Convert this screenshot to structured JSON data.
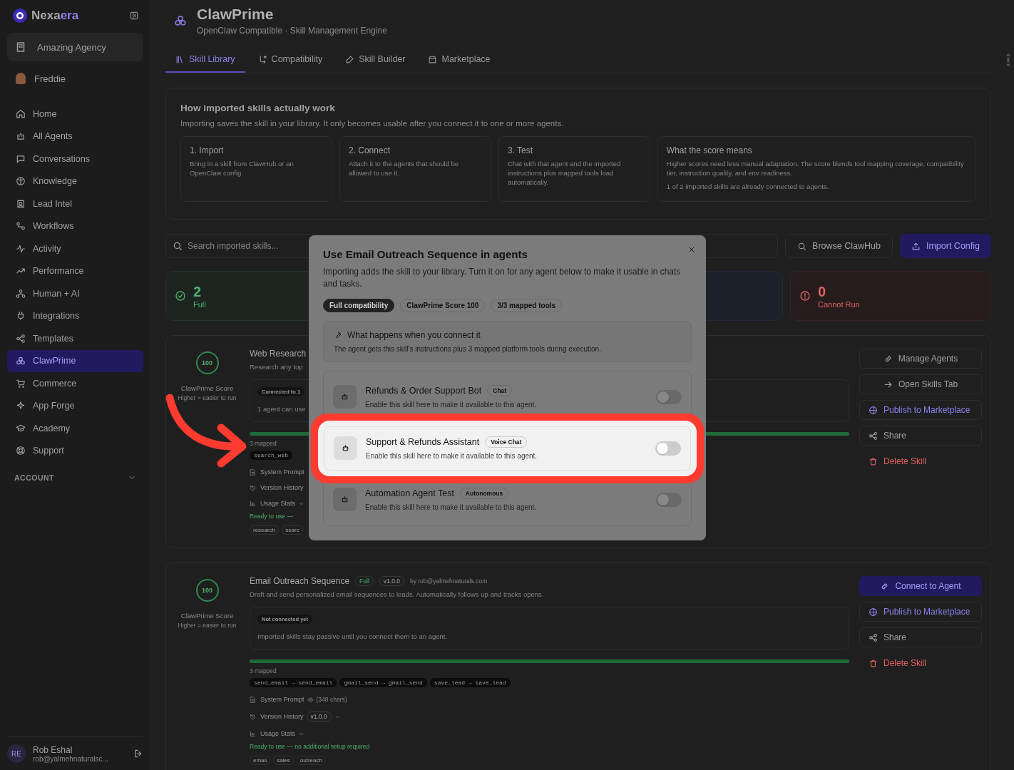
{
  "sidebar": {
    "logo": [
      {
        "text": "Nexa",
        "accent": false
      },
      {
        "text": "era",
        "accent": true
      }
    ],
    "workspace": "Amazing Agency",
    "user": "Freddie",
    "nav": [
      {
        "label": "Home",
        "selected": false
      },
      {
        "label": "All Agents",
        "selected": false
      },
      {
        "label": "Conversations",
        "selected": false
      },
      {
        "label": "Knowledge",
        "selected": false
      },
      {
        "label": "Lead Intel",
        "selected": false
      },
      {
        "label": "Workflows",
        "selected": false
      },
      {
        "label": "Activity",
        "selected": false
      },
      {
        "label": "Performance",
        "selected": false
      },
      {
        "label": "Human + AI",
        "selected": false
      },
      {
        "label": "Integrations",
        "selected": false
      },
      {
        "label": "Templates",
        "selected": false
      },
      {
        "label": "ClawPrime",
        "selected": true
      },
      {
        "label": "Commerce",
        "selected": false
      },
      {
        "label": "App Forge",
        "selected": false
      },
      {
        "label": "Academy",
        "selected": false
      },
      {
        "label": "Support",
        "selected": false
      }
    ],
    "section": "ACCOUNT",
    "footer": {
      "initials": "RE",
      "name": "Rob Eshal",
      "email": "rob@yalmehnaturalsc..."
    }
  },
  "header": {
    "title": "ClawPrime",
    "subtitle": "OpenClaw Compatible · Skill Management Engine"
  },
  "tabs": [
    {
      "label": "Skill Library",
      "selected": true
    },
    {
      "label": "Compatibility",
      "selected": false
    },
    {
      "label": "Skill Builder",
      "selected": false
    },
    {
      "label": "Marketplace",
      "selected": false
    }
  ],
  "info": {
    "title": "How imported skills actually work",
    "text": "Importing saves the skill in your library. It only becomes usable after you connect it to one or more agents.",
    "steps": [
      {
        "title": "1. Import",
        "text": "Bring in a skill from ClawHub or an OpenClaw config."
      },
      {
        "title": "2. Connect",
        "text": "Attach it to the agents that should be allowed to use it."
      },
      {
        "title": "3. Test",
        "text": "Chat with that agent and the imported instructions plus mapped tools load automatically."
      },
      {
        "title": "What the score means",
        "text": "Higher scores need less manual adaptation. The score blends tool mapping coverage, compatibility tier, instruction quality, and env readiness.",
        "note": "1 of 2 imported skills are already connected to agents."
      }
    ]
  },
  "search": {
    "placeholder": "Search imported skills..."
  },
  "actions": [
    {
      "label": "Browse ClawHub",
      "kind": "outline"
    },
    {
      "label": "Import Config",
      "kind": "primary"
    }
  ],
  "stats": [
    {
      "kind": "green",
      "value": "2",
      "label": "Full"
    },
    {
      "kind": "blue"
    },
    {
      "kind": "red",
      "value": "0",
      "label": "Cannot Run"
    }
  ],
  "skills": [
    {
      "score": "100",
      "score_label": "ClawPrime Score",
      "score_hint": "Higher = easier to run",
      "title": "Web Research",
      "description": "Research any top",
      "status": "Connected to 1",
      "status_text": "1 agent can use",
      "level": 1,
      "mapped": "3 mapped",
      "tools": [
        "search_web"
      ],
      "prompt": "System Prompt",
      "history": "Version History",
      "usage": "Usage Stats",
      "ready": "Ready to use —",
      "tags": [
        "research",
        "searc"
      ],
      "buttons": [
        {
          "label": "Manage Agents",
          "kind": "outline"
        },
        {
          "label": "Open Skills Tab",
          "kind": "outline"
        },
        {
          "label": "Publish to Marketplace",
          "kind": "publish"
        },
        {
          "label": "Share",
          "kind": "share"
        },
        {
          "label": "Delete Skill",
          "kind": "danger"
        }
      ]
    },
    {
      "score": "100",
      "score_label": "ClawPrime Score",
      "score_hint": "Higher = easier to run",
      "title": "Email Outreach Sequence",
      "tier": "Full",
      "version": "v1.0.0",
      "author": "by rob@yalmehnaturals.com",
      "description": "Draft and send personalized email sequences to leads. Automatically follows up and tracks opens.",
      "status": "Not connected yet",
      "status_text": "Imported skills stay passive until you connect them to an agent.",
      "level": 1,
      "mapped": "3 mapped",
      "tools": [
        "send_email → send_email",
        "gmail_send → gmail_send",
        "save_lead → save_lead"
      ],
      "prompt": "System Prompt",
      "prompt_size": "(348 chars)",
      "history": "Version History",
      "history_version": "v1.0.0",
      "usage": "Usage Stats",
      "ready": "Ready to use — no additional setup required",
      "tags": [
        "email",
        "sales",
        "outreach"
      ],
      "buttons": [
        {
          "label": "Connect to Agent",
          "kind": "primary"
        },
        {
          "label": "Publish to Marketplace",
          "kind": "publish"
        },
        {
          "label": "Share",
          "kind": "share"
        },
        {
          "label": "Delete Skill",
          "kind": "danger"
        }
      ]
    }
  ],
  "modal": {
    "title": "Use Email Outreach Sequence in agents",
    "text": "Importing adds the skill to your library. Turn it on for any agent below to make it usable in chats and tasks.",
    "chips": [
      {
        "label": "Full compatibility",
        "kind": "dark"
      },
      {
        "label": "ClawPrime Score 100",
        "kind": "outline"
      },
      {
        "label": "3/3 mapped tools",
        "kind": "outline"
      }
    ],
    "note": {
      "title": "What happens when you connect it",
      "text": "The agent gets this skill's instructions plus 3 mapped platform tools during execution."
    },
    "agents": [
      {
        "name": "Refunds & Order Support Bot",
        "tag": "Chat",
        "text": "Enable this skill here to make it available to this agent.",
        "on": false,
        "highlighted": false
      },
      {
        "name": "Support & Refunds Assistant",
        "tag": "Voice Chat",
        "text": "Enable this skill here to make it available to this agent.",
        "on": false,
        "highlighted": true
      },
      {
        "name": "Automation Agent Test",
        "tag": "Autonomous",
        "text": "Enable this skill here to make it available to this agent.",
        "on": false,
        "highlighted": false
      }
    ]
  }
}
